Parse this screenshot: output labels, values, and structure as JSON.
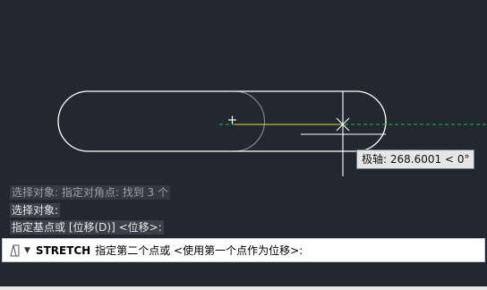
{
  "tooltip": {
    "label": "极轴:",
    "value": "268.6001",
    "angle": "< 0°"
  },
  "history": [
    {
      "text": "选择对象: 指定对角点: 找到 3 个"
    },
    {
      "text": "选择对象:"
    },
    {
      "text": "指定基点或 [位移(D)] <位移>:"
    }
  ],
  "command_line": {
    "icon": "command-prompt-icon",
    "command": "STRETCH",
    "prompt": "指定第二个点或 <使用第一个点作为位移>:"
  },
  "colors": {
    "background": "#212830",
    "geometry": "#ffffff",
    "ghost_geometry": "#9a9a9a",
    "polar_tracking": "#22b84a",
    "highlight": "#e0e040"
  }
}
